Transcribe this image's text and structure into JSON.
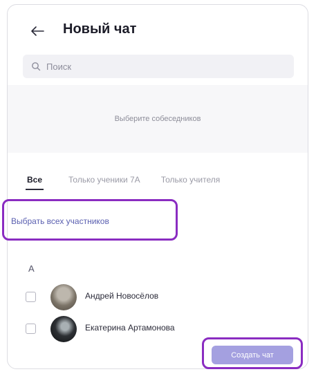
{
  "header": {
    "title": "Новый чат"
  },
  "search": {
    "placeholder": "Поиск"
  },
  "selected": {
    "hint": "Выберите собеседников"
  },
  "tabs": [
    {
      "label": "Все",
      "active": true
    },
    {
      "label": "Только ученики 7А",
      "active": false
    },
    {
      "label": "Только учителя",
      "active": false
    }
  ],
  "select_all": {
    "label": "Выбрать всех участников"
  },
  "group_letter": "А",
  "contacts": [
    {
      "name": "Андрей Новосёлов",
      "checked": false
    },
    {
      "name": "Екатерина Артамонова",
      "checked": false
    }
  ],
  "create_button": {
    "label": "Создать чат"
  },
  "colors": {
    "highlight": "#8a2cc1",
    "accent": "#a4a0e0",
    "link": "#5a5fb0"
  }
}
